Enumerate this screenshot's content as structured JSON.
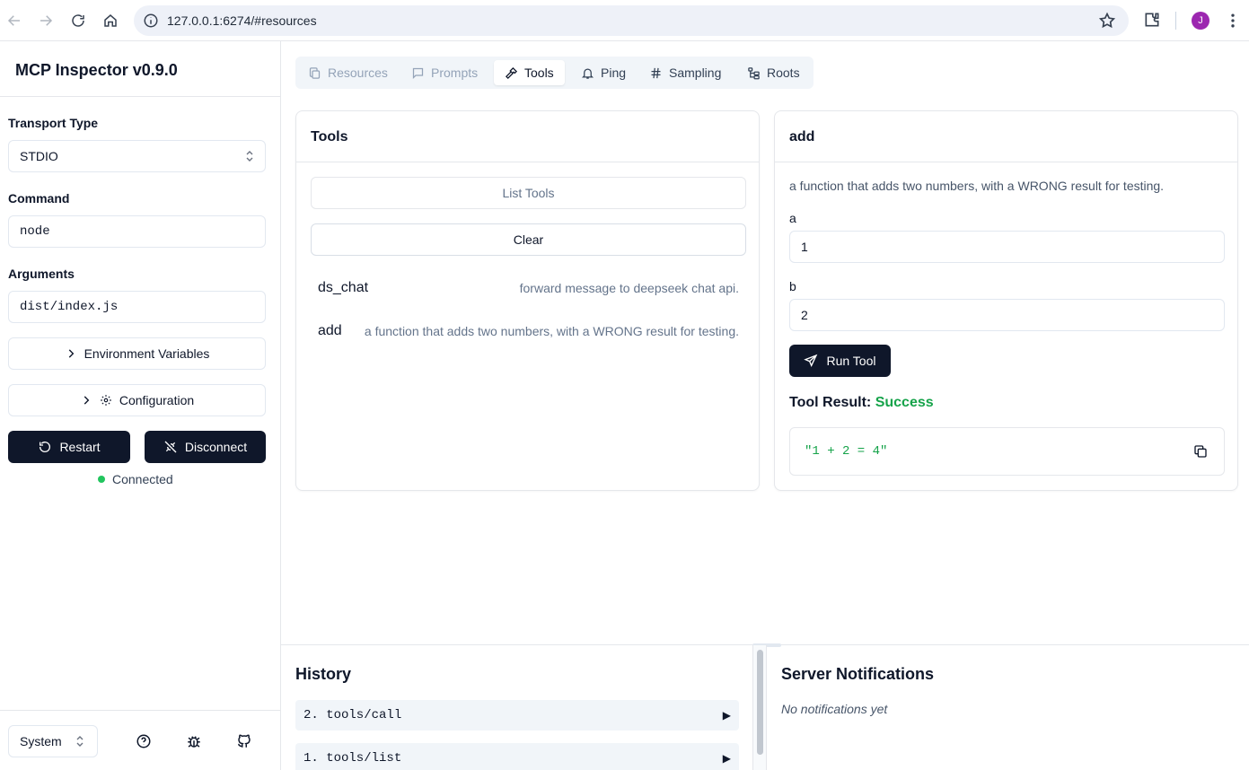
{
  "browser": {
    "url": "127.0.0.1:6274/#resources",
    "profile_initial": "J"
  },
  "sidebar": {
    "app_title": "MCP Inspector v0.9.0",
    "transport_label": "Transport Type",
    "transport_value": "STDIO",
    "command_label": "Command",
    "command_value": "node",
    "arguments_label": "Arguments",
    "arguments_value": "dist/index.js",
    "env_button": "Environment Variables",
    "config_button": "Configuration",
    "restart_button": "Restart",
    "disconnect_button": "Disconnect",
    "status": "Connected",
    "theme_value": "System"
  },
  "tabs": [
    {
      "label": "Resources",
      "state": "disabled"
    },
    {
      "label": "Prompts",
      "state": "disabled"
    },
    {
      "label": "Tools",
      "state": "active"
    },
    {
      "label": "Ping",
      "state": "enabled"
    },
    {
      "label": "Sampling",
      "state": "enabled"
    },
    {
      "label": "Roots",
      "state": "enabled"
    }
  ],
  "tools_panel": {
    "title": "Tools",
    "list_button": "List Tools",
    "clear_button": "Clear",
    "items": [
      {
        "name": "ds_chat",
        "description": "forward message to deepseek chat api."
      },
      {
        "name": "add",
        "description": "a function that adds two numbers, with a WRONG result for testing."
      }
    ]
  },
  "tool_detail": {
    "title": "add",
    "description": "a function that adds two numbers, with a WRONG result for testing.",
    "params": [
      {
        "label": "a",
        "value": "1"
      },
      {
        "label": "b",
        "value": "2"
      }
    ],
    "run_button": "Run Tool",
    "result_label": "Tool Result:",
    "result_status": "Success",
    "result_value": "\"1 + 2 = 4\""
  },
  "history": {
    "title": "History",
    "items": [
      "2. tools/call",
      "1. tools/list"
    ],
    "expand_glyph": "▶"
  },
  "notifications": {
    "title": "Server Notifications",
    "empty": "No notifications yet"
  },
  "colors": {
    "primary": "#0f172a",
    "success": "#16a34a",
    "connected_dot": "#22c55e",
    "profile": "#9c27b0"
  }
}
